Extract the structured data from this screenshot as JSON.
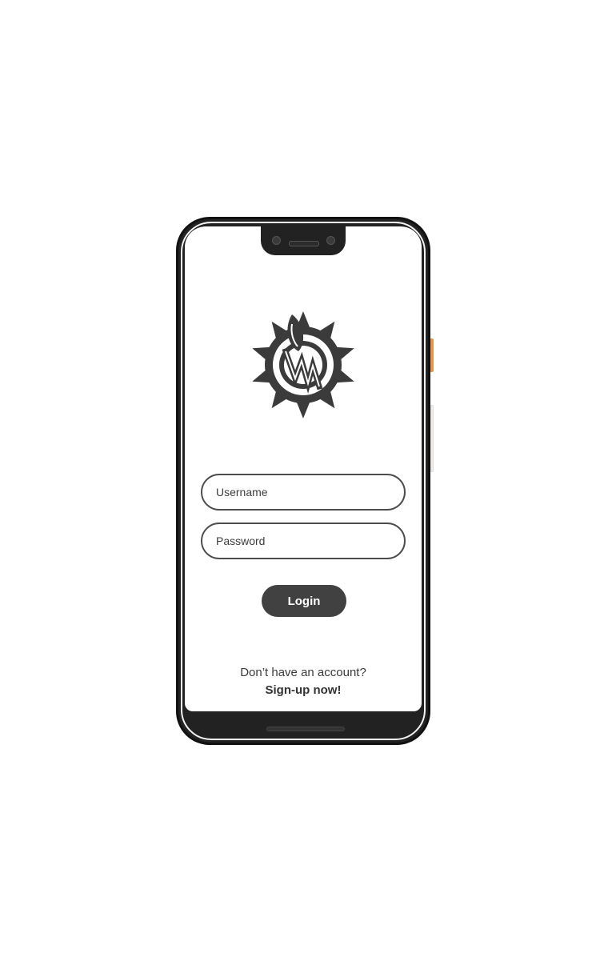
{
  "app": {
    "logo_icon": "sun-pen-logo-icon"
  },
  "login_form": {
    "username_placeholder": "Username",
    "password_placeholder": "Password",
    "login_label": "Login"
  },
  "signup": {
    "prompt": "Don’t have an account?",
    "link_label": "Sign-up now!"
  },
  "colors": {
    "button_bg": "#414141",
    "field_border": "#4d4d4d",
    "phone_body": "#222222",
    "side_button_accent": "#e8944a"
  }
}
